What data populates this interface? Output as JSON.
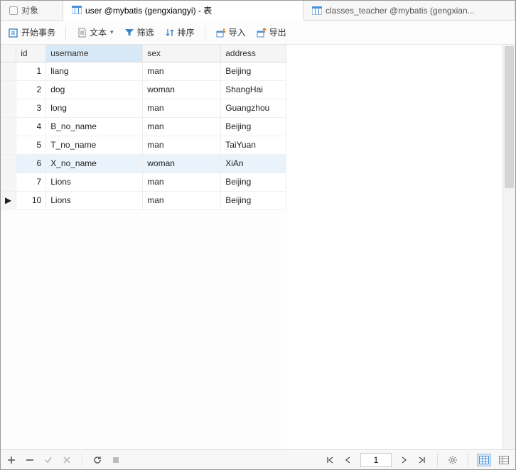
{
  "tabs": {
    "objects": "对象",
    "active": "user @mybatis (gengxiangyi) - 表",
    "inactive": "classes_teacher @mybatis (gengxian..."
  },
  "toolbar": {
    "begin_tx": "开始事务",
    "text": "文本",
    "filter": "筛选",
    "sort": "排序",
    "import": "导入",
    "export": "导出"
  },
  "columns": {
    "id": "id",
    "username": "username",
    "sex": "sex",
    "address": "address"
  },
  "rows": [
    {
      "marker": "",
      "id": 1,
      "username": "liang",
      "sex": "man",
      "address": "Beijing"
    },
    {
      "marker": "",
      "id": 2,
      "username": "dog",
      "sex": "woman",
      "address": "ShangHai"
    },
    {
      "marker": "",
      "id": 3,
      "username": "long",
      "sex": "man",
      "address": "Guangzhou"
    },
    {
      "marker": "",
      "id": 4,
      "username": "B_no_name",
      "sex": "man",
      "address": "Beijing"
    },
    {
      "marker": "",
      "id": 5,
      "username": "T_no_name",
      "sex": "man",
      "address": "TaiYuan"
    },
    {
      "marker": "",
      "id": 6,
      "username": "X_no_name",
      "sex": "woman",
      "address": "XiAn"
    },
    {
      "marker": "",
      "id": 7,
      "username": "Lions",
      "sex": "man",
      "address": "Beijing"
    },
    {
      "marker": "▶",
      "id": 10,
      "username": "Lions",
      "sex": "man",
      "address": "Beijing"
    }
  ],
  "status": {
    "page": "1"
  }
}
